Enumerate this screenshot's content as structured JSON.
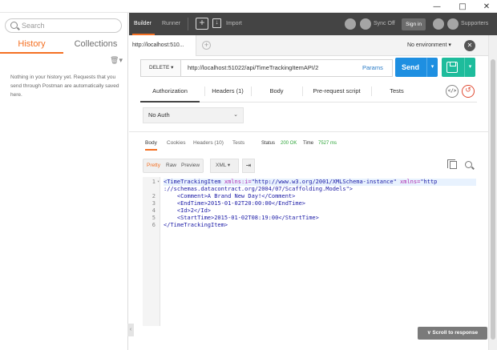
{
  "window": {
    "minimize": "—",
    "maximize": "□",
    "close": "✕"
  },
  "sidebar": {
    "search_placeholder": "Search",
    "tabs": [
      {
        "label": "History",
        "active": true
      },
      {
        "label": "Collections",
        "active": false
      }
    ],
    "tools_icon": "🗑▾",
    "history_empty": "Nothing in your history yet. Requests that you send through Postman are automatically saved here."
  },
  "toolbar": {
    "builder": "Builder",
    "runner": "Runner",
    "import": "Import",
    "sync": "Sync Off",
    "signin": "Sign in",
    "supporters": "Supporters",
    "accent": "#f47023"
  },
  "request_tabs": {
    "active_tab": "http://localhost:510...",
    "add": "+",
    "environment": "No environment  ▾",
    "env_icon": "settings-icon"
  },
  "request": {
    "method": "DELETE ▾",
    "url": "http://localhost:51022/api/TimeTrackingItemAPI/2",
    "params": "Params",
    "send": "Send",
    "send_caret": "▾",
    "save_caret": "▾"
  },
  "request_subtabs": [
    "Authorization",
    "Headers (1)",
    "Body",
    "Pre-request script",
    "Tests"
  ],
  "auth": {
    "value": "No Auth",
    "caret": "⌄"
  },
  "response": {
    "tabs": [
      "Body",
      "Cookies",
      "Headers (10)",
      "Tests"
    ],
    "status_label": "Status",
    "status_value": "200 OK",
    "time_label": "Time",
    "time_value": "7527 ms",
    "views": [
      "Pretty",
      "Raw",
      "Preview"
    ],
    "format": "XML ▾",
    "wrap": "⇥",
    "lines": [
      {
        "n": "1",
        "fold": "▾",
        "tag_open": "<TimeTrackingItem",
        "attr1": " xmlns:i=",
        "val1": "\"http://www.w3.org/2001/XMLSchema-instance\"",
        "attr2": " xmlns=",
        "val2": "\"http"
      },
      {
        "cont": "://schemas.datacontract.org/2004/07/Scaffolding.Models\">"
      },
      {
        "n": "2",
        "text": "    <Comment>A Brand New Day!</Comment>"
      },
      {
        "n": "3",
        "text": "    <EndTime>2015-01-02T20:00:00</EndTime>"
      },
      {
        "n": "4",
        "text": "    <Id>2</Id>"
      },
      {
        "n": "5",
        "text": "    <StartTime>2015-01-02T08:19:00</StartTime>"
      },
      {
        "n": "6",
        "text": "</TimeTrackingItem>"
      }
    ]
  },
  "scroll_to_response": "∨ Scroll to response"
}
